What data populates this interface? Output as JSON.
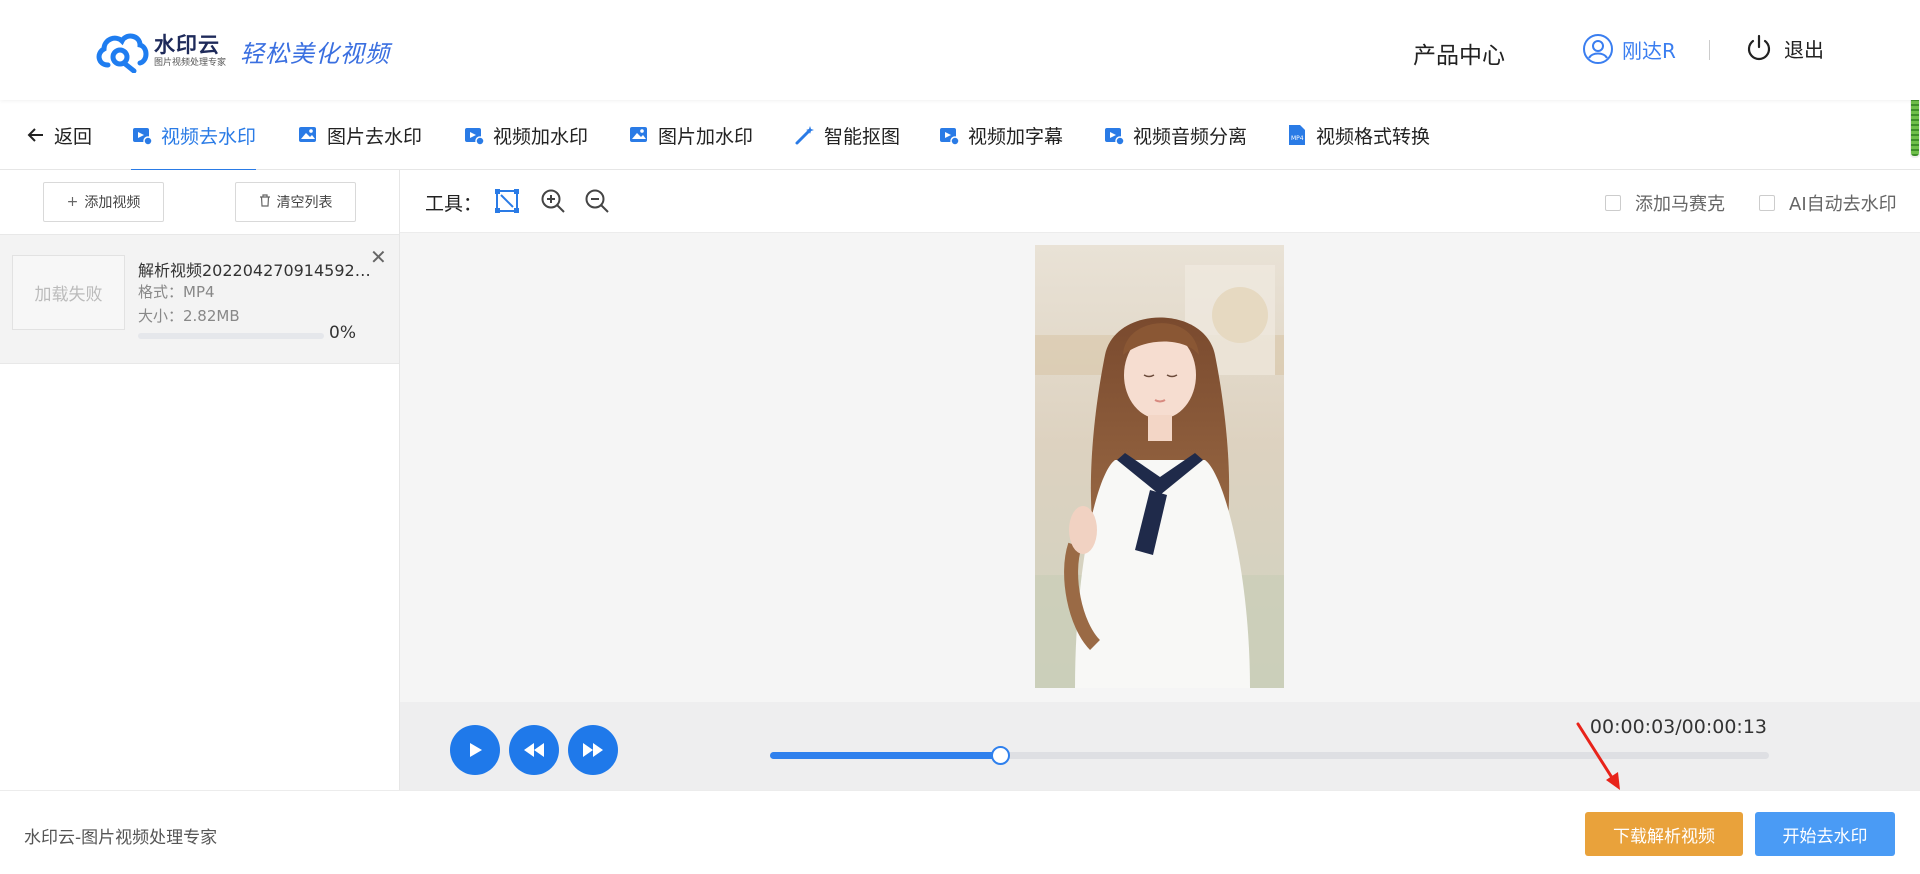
{
  "header": {
    "logo_name": "水印云",
    "logo_sub": "图片视频处理专家",
    "slogan": "轻松美化视频",
    "product_center": "产品中心",
    "username": "刚达R",
    "logout": "退出"
  },
  "tabs": [
    {
      "label": "返回",
      "icon": "arrow-left-icon"
    },
    {
      "label": "视频去水印",
      "icon": "video-icon",
      "active": true
    },
    {
      "label": "图片去水印",
      "icon": "image-icon"
    },
    {
      "label": "视频加水印",
      "icon": "video-icon"
    },
    {
      "label": "图片加水印",
      "icon": "image-icon"
    },
    {
      "label": "智能抠图",
      "icon": "magic-wand-icon"
    },
    {
      "label": "视频加字幕",
      "icon": "video-icon"
    },
    {
      "label": "视频音频分离",
      "icon": "video-icon"
    },
    {
      "label": "视频格式转换",
      "icon": "mp4-file-icon"
    }
  ],
  "sidebar": {
    "add_video": "添加视频",
    "clear_list": "清空列表",
    "file": {
      "thumb_status": "加载失败",
      "name": "解析视频20220427091459207...",
      "format": "格式：MP4",
      "size": "大小：2.82MB",
      "progress_percent": 0,
      "progress_label": "0%"
    }
  },
  "toolbar": {
    "label": "工具：",
    "tools": [
      "select-region-icon",
      "zoom-in-icon",
      "zoom-out-icon"
    ],
    "option_mosaic": "添加马赛克",
    "option_ai": "AI自动去水印"
  },
  "player": {
    "time": "00:00:03/00:00:13",
    "progress_fraction": 0.23
  },
  "footer": {
    "tagline": "水印云-图片视频处理专家",
    "download_label": "下载解析视频",
    "start_label": "开始去水印"
  },
  "colors": {
    "accent": "#2a7be6",
    "download_button": "#e9a23b",
    "start_button": "#4a9bf5",
    "annotation_arrow": "#e8231a"
  }
}
